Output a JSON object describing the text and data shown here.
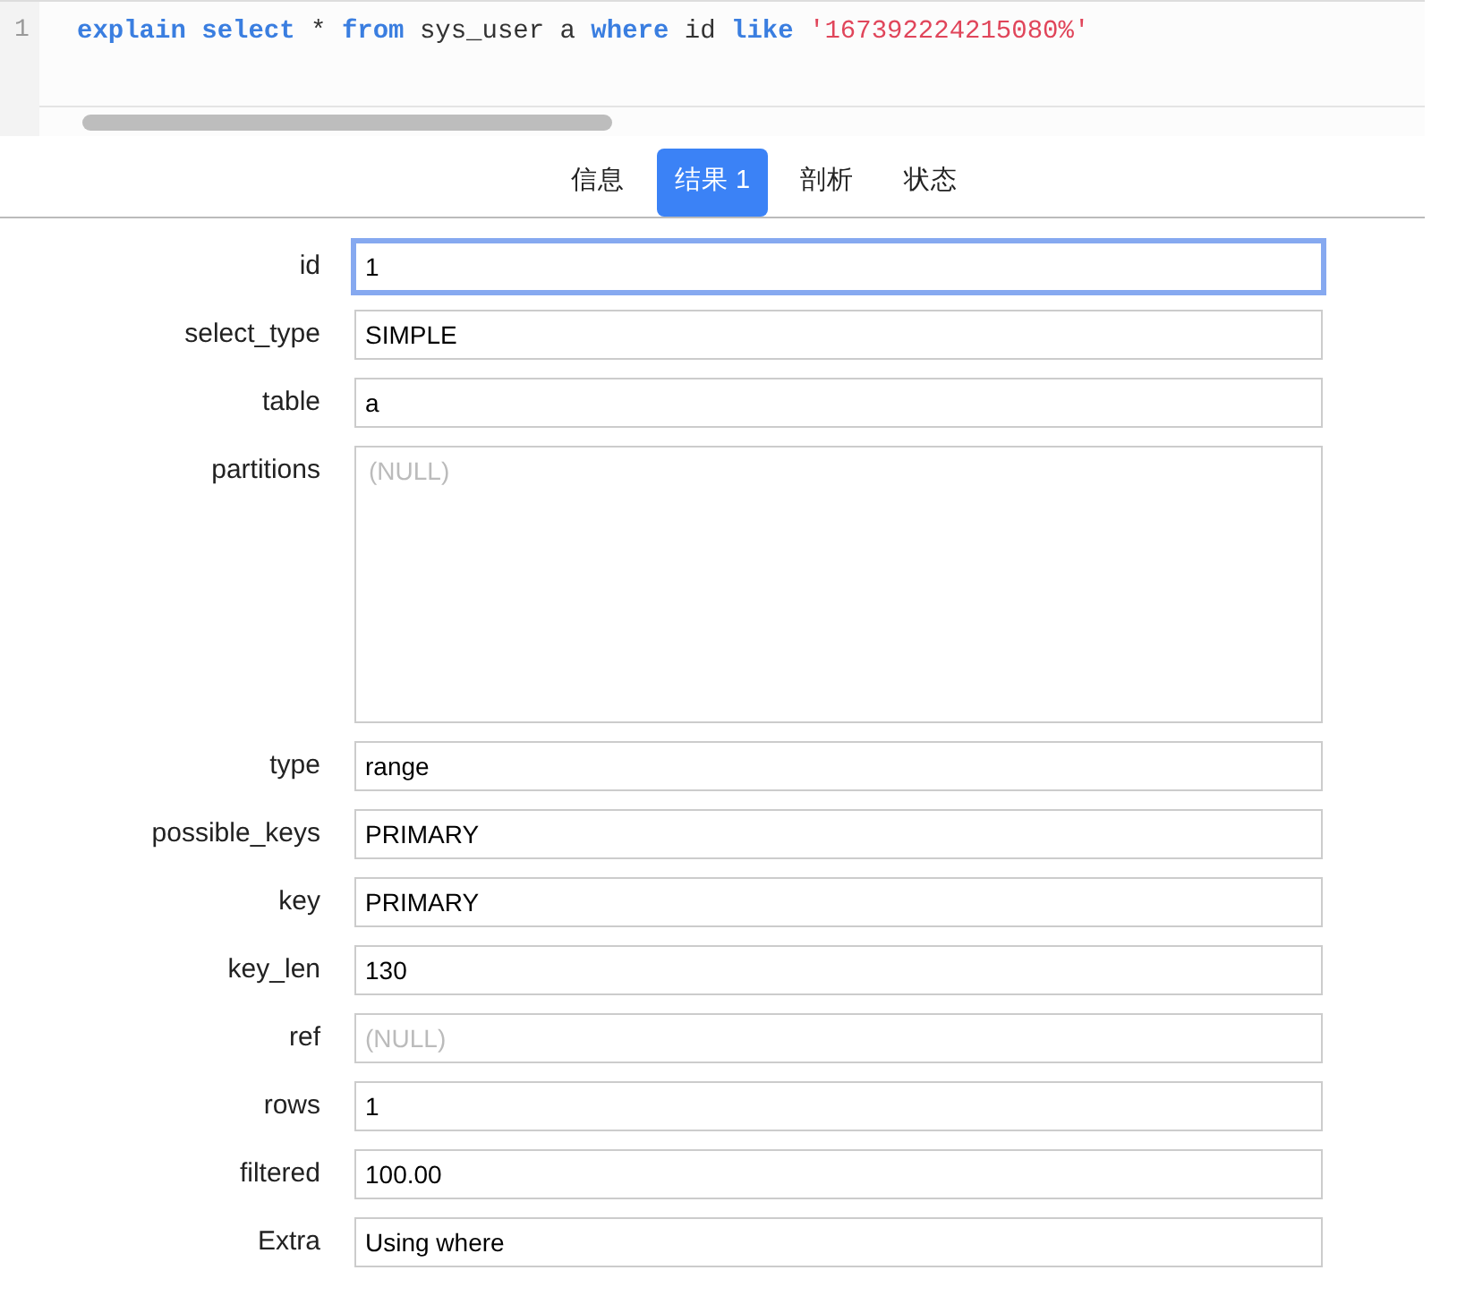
{
  "editor": {
    "line_number": "1",
    "code": [
      {
        "kind": "keyword",
        "text": "explain select"
      },
      {
        "kind": "plain",
        "text": " * "
      },
      {
        "kind": "keyword",
        "text": "from"
      },
      {
        "kind": "plain",
        "text": " sys_user a "
      },
      {
        "kind": "keyword",
        "text": "where"
      },
      {
        "kind": "plain",
        "text": " id "
      },
      {
        "kind": "keyword",
        "text": "like "
      },
      {
        "kind": "string",
        "text": "'167392224215080%'"
      }
    ]
  },
  "tabs": [
    {
      "label": "信息",
      "selected": false
    },
    {
      "label": "结果 1",
      "selected": true
    },
    {
      "label": "剖析",
      "selected": false
    },
    {
      "label": "状态",
      "selected": false
    }
  ],
  "fields": [
    {
      "label": "id",
      "kind": "text",
      "value": "1",
      "focused": true
    },
    {
      "label": "select_type",
      "kind": "text",
      "value": "SIMPLE",
      "focused": false
    },
    {
      "label": "table",
      "kind": "text",
      "value": "a",
      "focused": false
    },
    {
      "label": "partitions",
      "kind": "textarea",
      "placeholder": "(NULL)",
      "focused": false
    },
    {
      "label": "type",
      "kind": "text",
      "value": "range",
      "focused": false
    },
    {
      "label": "possible_keys",
      "kind": "text",
      "value": "PRIMARY",
      "focused": false
    },
    {
      "label": "key",
      "kind": "text",
      "value": "PRIMARY",
      "focused": false
    },
    {
      "label": "key_len",
      "kind": "text",
      "value": "130",
      "focused": false
    },
    {
      "label": "ref",
      "kind": "text",
      "placeholder": "(NULL)",
      "focused": false
    },
    {
      "label": "rows",
      "kind": "text",
      "value": "1",
      "focused": false
    },
    {
      "label": "filtered",
      "kind": "text",
      "value": "100.00",
      "focused": false
    },
    {
      "label": "Extra",
      "kind": "text",
      "value": "Using where",
      "focused": false
    }
  ]
}
